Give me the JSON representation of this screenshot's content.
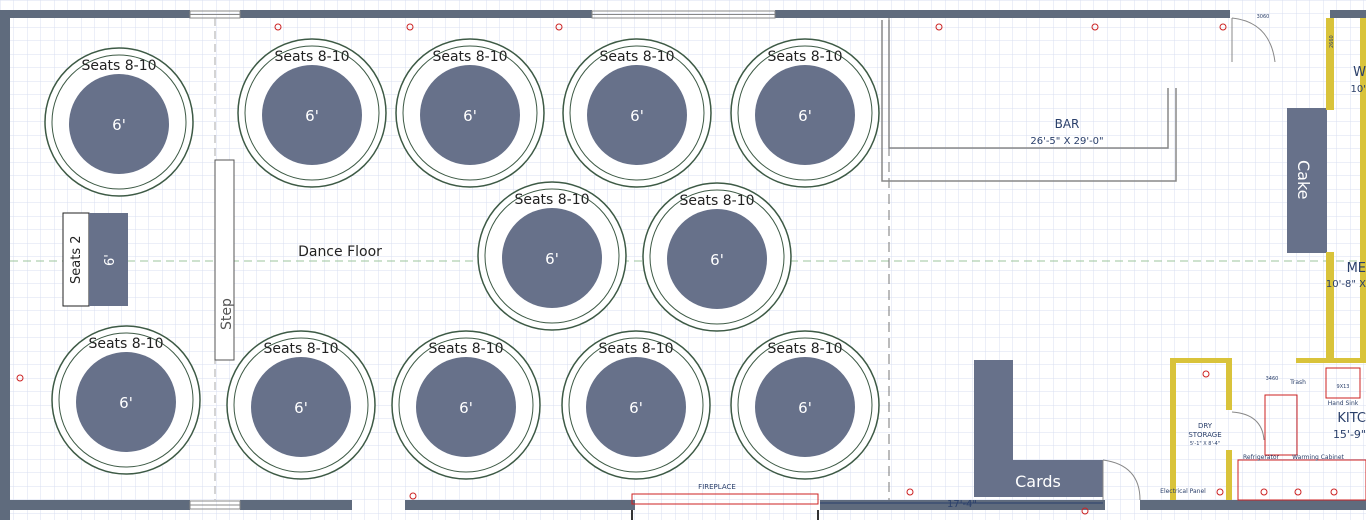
{
  "room": {
    "dance_floor_label": "Dance Floor",
    "step_label": "Step",
    "bar_label": "BAR",
    "bar_dims": "26'-5\" X 29'-0\"",
    "cake_label": "Cake",
    "cards_label": "Cards",
    "fireplace_label": "FIREPLACE",
    "dimension_label": "17'-4\"",
    "dry_storage_label": "DRY",
    "dry_storage_label2": "STORAGE",
    "dry_storage_dims": "5'-1\" X 8'-4\"",
    "kitchen_label": "KITC",
    "kitchen_dims": "15'-9\"",
    "hand_sink_label": "Hand Sink",
    "trash_label": "Trash",
    "refrigerator_label": "Refrigerator",
    "warming_cabinet_label": "Warming Cabinet",
    "electrical_panel_label": "Electrical Panel",
    "side_label_w": "W",
    "side_dims_w": "10'",
    "side_label_me": "ME",
    "side_dims_me": "10'-8\" X",
    "small_note": "3060",
    "small_note2": "9X13",
    "small_note3": "2660",
    "small_note4": "3460"
  },
  "round_tables": [
    {
      "seats": "Seats 8-10",
      "size": "6'"
    },
    {
      "seats": "Seats 8-10",
      "size": "6'"
    },
    {
      "seats": "Seats 8-10",
      "size": "6'"
    },
    {
      "seats": "Seats 8-10",
      "size": "6'"
    },
    {
      "seats": "Seats 8-10",
      "size": "6'"
    },
    {
      "seats": "Seats 8-10",
      "size": "6'"
    },
    {
      "seats": "Seats 8-10",
      "size": "6'"
    },
    {
      "seats": "Seats 8-10",
      "size": "6'"
    },
    {
      "seats": "Seats 8-10",
      "size": "6'"
    },
    {
      "seats": "Seats 8-10",
      "size": "6'"
    },
    {
      "seats": "Seats 8-10",
      "size": "6'"
    },
    {
      "seats": "Seats 8-10",
      "size": "6'"
    }
  ],
  "sweetheart_table": {
    "seats": "Seats 2",
    "size": "6'"
  },
  "colors": {
    "table_fill": "#67718A",
    "ring_stroke": "#3d5a45",
    "wall": "#5f6b7d",
    "grid": "#d8dff0",
    "kitchen_wall": "#d9c33a",
    "accent_red": "#cc2222"
  }
}
